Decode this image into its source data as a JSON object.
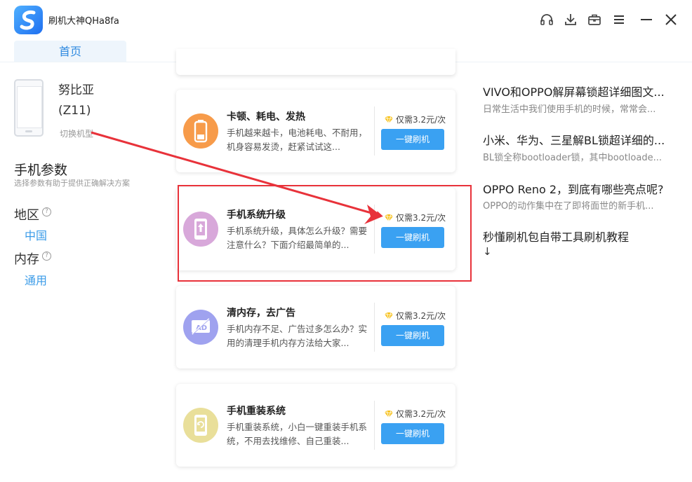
{
  "app": {
    "title": "刷机大神QHa8fa"
  },
  "tabs": [
    {
      "label": "首页"
    }
  ],
  "device": {
    "name": "努比亚",
    "model": "(Z11)",
    "switch_label": "切换机型"
  },
  "params": {
    "title": "手机参数",
    "subtitle": "选择参数有助于提供正确解决方案",
    "region_label": "地区",
    "region_value": "中国",
    "memory_label": "内存",
    "memory_value": "通用",
    "help_glyph": "?"
  },
  "cards": [
    {
      "title": "卡顿、耗电、发热",
      "desc": "手机越来越卡，电池耗电、不耐用，机身容易发烫，赶紧试试这...",
      "price": "仅需3.2元/次",
      "button": "一键刷机",
      "icon": "battery-icon",
      "icon_color": "#f79b4a"
    },
    {
      "title": "手机系统升级",
      "desc": "手机系统升级，具体怎么升级？需要注意什么？下面介绍最简单的...",
      "price": "仅需3.2元/次",
      "button": "一键刷机",
      "icon": "phone-upgrade-icon",
      "icon_color": "#d8a8da"
    },
    {
      "title": "清内存，去广告",
      "desc": "手机内存不足、广告过多怎么办？实用的清理手机内存方法给大家...",
      "price": "仅需3.2元/次",
      "button": "一键刷机",
      "icon": "ad-block-icon",
      "icon_color": "#9fa2ef"
    },
    {
      "title": "手机重装系统",
      "desc": "手机重装系统，小白一键重装手机系统，不用去找维修、自己重装...",
      "price": "仅需3.2元/次",
      "button": "一键刷机",
      "icon": "phone-reinstall-icon",
      "icon_color": "#e9df9a"
    }
  ],
  "articles": [
    {
      "title": "VIVO和OPPO解屏幕锁超详细图文...",
      "desc": "日常生活中我们使用手机的时候，常常会..."
    },
    {
      "title": "小米、华为、三星解BL锁超详细的...",
      "desc": "BL锁全称bootloader锁，其中bootloade..."
    },
    {
      "title": "OPPO Reno 2，到底有哪些亮点呢?",
      "desc": "OPPO的动作集中在了即将面世的新手机..."
    },
    {
      "title": "秒懂刷机包自带工具刷机教程",
      "desc": "↓"
    }
  ],
  "colors": {
    "accent": "#3aa1f2",
    "annotation": "#e8323a",
    "link": "#3a9be8"
  },
  "toolbar_icons": [
    "headset-icon",
    "download-icon",
    "briefcase-icon",
    "menu-icon",
    "minimize-icon",
    "close-icon"
  ]
}
